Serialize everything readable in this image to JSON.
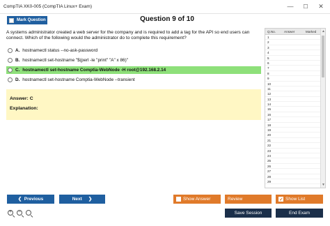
{
  "window": {
    "title": "CompTIA XK0-005 (CompTIA Linux+ Exam)",
    "minimize": "—",
    "maximize": "☐",
    "close": "✕"
  },
  "toolbar": {
    "mark_label": "Mark Question"
  },
  "question": {
    "header": "Question 9 of 10",
    "text": "A systems administrator created a web server for the company and is required to add a tag for the API so end users can connect. Which of the following would the administrator do to complete this requirement?",
    "options": [
      {
        "letter": "A.",
        "text": "hostnamectl status --no-ask-password",
        "correct": false
      },
      {
        "letter": "B.",
        "text": "hostnamectl set-hostname \"$(perl -le \"print\" \"A\" x 86)\"",
        "correct": false
      },
      {
        "letter": "C.",
        "text": "hostnamectl set-hostname Comptia-WebNode -H root@192.168.2.14",
        "correct": true
      },
      {
        "letter": "D.",
        "text": "hostnamectl set-hostname Comptia-WebNode --transient",
        "correct": false
      }
    ]
  },
  "answer_panel": {
    "answer_label": "Answer: C",
    "explanation_label": "Explanation:"
  },
  "question_list": {
    "columns": [
      "Q.No.",
      "Answer",
      "Marked"
    ],
    "rows": [
      "1",
      "2",
      "3",
      "4",
      "5",
      "6",
      "7",
      "8",
      "9",
      "10",
      "11",
      "12",
      "13",
      "14",
      "15",
      "16",
      "17",
      "18",
      "19",
      "20",
      "21",
      "22",
      "23",
      "24",
      "25",
      "26",
      "27",
      "28",
      "29"
    ]
  },
  "buttons": {
    "previous": "Previous",
    "next": "Next",
    "show_answer": "Show Answer",
    "review": "Review",
    "show_list": "Show List",
    "save_session": "Save Session",
    "end_exam": "End Exam"
  },
  "icons": {
    "prev_arrow": "❮",
    "next_arrow": "❯",
    "zoom_in": "+",
    "zoom_out": "−",
    "zoom_reset": "",
    "scroll_up": "▲",
    "scroll_down": "▼"
  },
  "colors": {
    "primary_blue": "#1f5fa0",
    "orange": "#e07a2a",
    "dark_navy": "#1b2f4a",
    "correct_green": "#8ee07a",
    "answer_yellow": "#fff7c4"
  }
}
